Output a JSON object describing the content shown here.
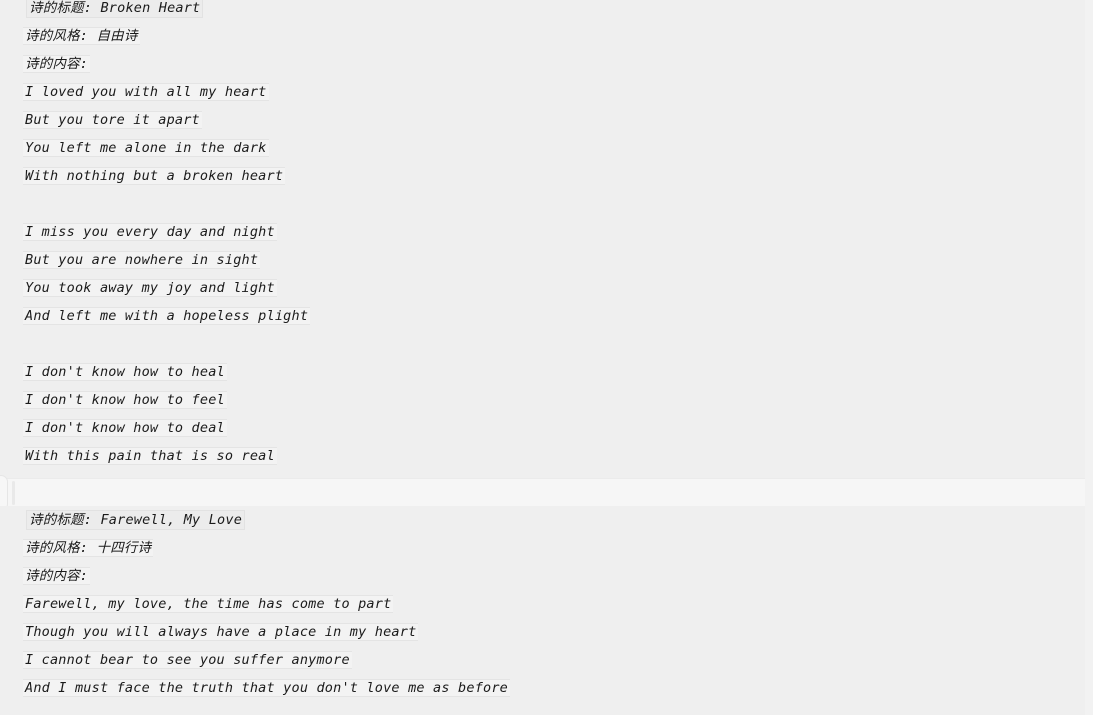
{
  "page": {
    "background_color": "#efefef",
    "text_color": "#1b1b1b",
    "line_highlight_color": "#f3f3f3",
    "divider_color": "#f6f6f6"
  },
  "poems": [
    {
      "title_line": "诗的标题: Broken Heart",
      "style_line": "诗的风格: 自由诗",
      "content_label": "诗的内容:",
      "lines": [
        "I loved you with all my heart",
        "But you tore it apart",
        "You left me alone in the dark",
        "With nothing but a broken heart",
        "",
        "I miss you every day and night",
        "But you are nowhere in sight",
        "You took away my joy and light",
        "And left me with a hopeless plight",
        "",
        "I don't know how to heal",
        "I don't know how to feel",
        "I don't know how to deal",
        "With this pain that is so real"
      ]
    },
    {
      "title_line": "诗的标题: Farewell, My Love",
      "style_line": "诗的风格: 十四行诗",
      "content_label": "诗的内容:",
      "lines": [
        "Farewell, my love, the time has come to part",
        "Though you will always have a place in my heart",
        "I cannot bear to see you suffer anymore",
        "And I must face the truth that you don't love me as before"
      ]
    }
  ],
  "divider": {
    "handle_name": "drag-handle",
    "tick_name": "separator-tick"
  }
}
